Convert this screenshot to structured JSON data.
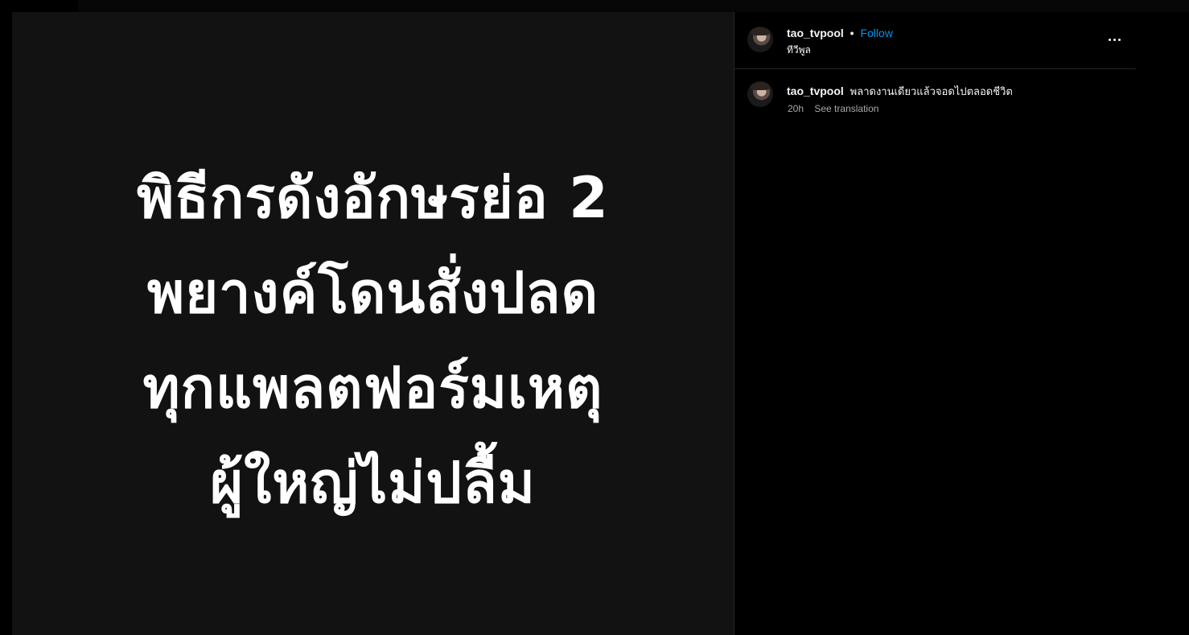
{
  "media": {
    "lines": [
      "พิธีกรดังอักษรย่อ 2",
      "พยางค์โดนสั่งปลด",
      "ทุกแพลตฟอร์มเหตุ",
      "ผู้ใหญ่ไม่ปลื้ม"
    ]
  },
  "header": {
    "username": "tao_tvpool",
    "separator": "•",
    "follow_label": "Follow",
    "subtitle": "ทีวีพูล",
    "more_icon": "more-options-icon"
  },
  "caption": {
    "username": "tao_tvpool",
    "text": "พลาดงานเดียวแล้วจอดไปตลอดชีวิต",
    "time": "20h",
    "see_translation": "See translation"
  },
  "colors": {
    "background": "#000000",
    "media_background": "#121212",
    "link": "#0095f6",
    "text": "#f5f5f5",
    "muted": "#a8a8a8",
    "divider": "#262626"
  }
}
